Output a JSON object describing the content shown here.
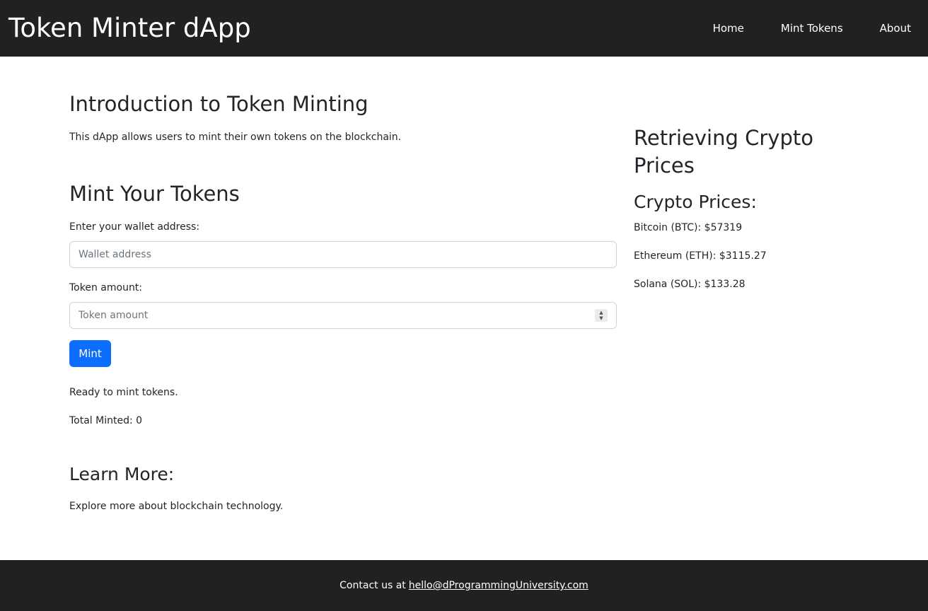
{
  "header": {
    "brand": "Token Minter dApp",
    "nav": [
      "Home",
      "Mint Tokens",
      "About"
    ]
  },
  "intro": {
    "title": "Introduction to Token Minting",
    "text": "This dApp allows users to mint their own tokens on the blockchain."
  },
  "mint": {
    "title": "Mint Your Tokens",
    "wallet_label": "Enter your wallet address:",
    "wallet_placeholder": "Wallet address",
    "amount_label": "Token amount:",
    "amount_placeholder": "Token amount",
    "button_label": "Mint",
    "status": "Ready to mint tokens.",
    "total": "Total Minted: 0"
  },
  "learn": {
    "title": "Learn More:",
    "text": "Explore more about blockchain technology."
  },
  "sidebar": {
    "title": "Retrieving Crypto Prices",
    "subtitle": "Crypto Prices:",
    "prices": [
      "Bitcoin (BTC): $57319",
      "Ethereum (ETH): $3115.27",
      "Solana (SOL): $133.28"
    ]
  },
  "footer": {
    "text": "Contact us at",
    "email": "hello@dProgrammingUniversity.com"
  },
  "colors": {
    "navbar": "#212121",
    "primary": "#0d6efd"
  }
}
